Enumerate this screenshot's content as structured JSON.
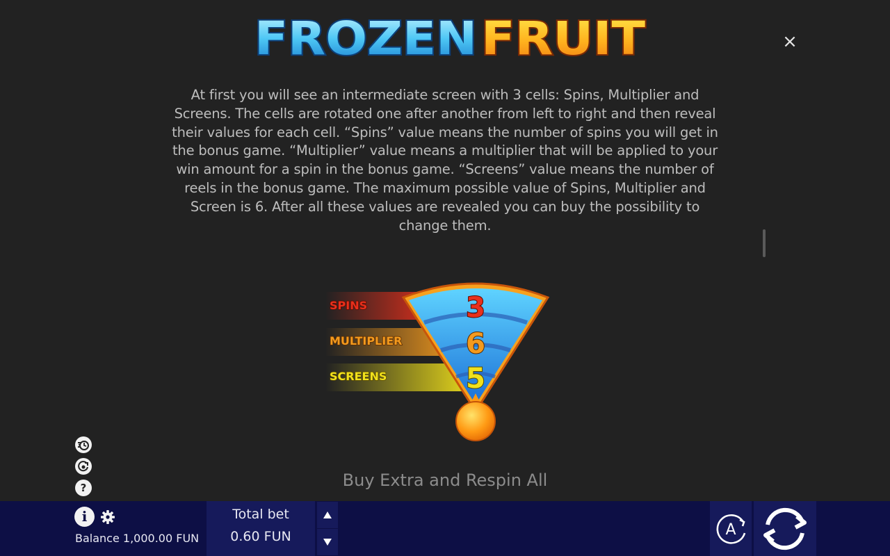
{
  "logo": {
    "text_part1": "FROZEN",
    "text_part2": "FRUIT"
  },
  "close_label": "×",
  "rules": {
    "paragraph": "At first you will see an intermediate screen with 3 cells: Spins, Multiplier and Screens. The cells are rotated one after another from left to right and then reveal their values for each cell. “Spins” value means the number of spins you will get in the bonus game. “Multiplier” value means a multiplier that will be applied to your win amount for a spin in the bonus game. “Screens” value means the number of reels in the bonus game. The maximum possible value of Spins, Multiplier and Screen is 6. After all these values are revealed you can buy the possibility to change them.",
    "illustration": {
      "rows": [
        {
          "label": "SPINS",
          "value": "3",
          "color": "#e8301c"
        },
        {
          "label": "MULTIPLIER",
          "value": "6",
          "color": "#f39a1e"
        },
        {
          "label": "SCREENS",
          "value": "5",
          "color": "#f1e11c"
        }
      ]
    },
    "next_heading": "Buy Extra and Respin All"
  },
  "side_icons": [
    "turbo-icon",
    "autoplay-history-icon",
    "help-icon"
  ],
  "side_help_glyph": "?",
  "bottom_bar": {
    "info_glyph": "i",
    "balance_text": "Balance 1,000.00 FUN",
    "total_bet_label": "Total bet",
    "total_bet_value": "0.60 FUN",
    "auto_label": "A",
    "colors": {
      "bar": "#0d0f45",
      "panel": "#161a5b"
    }
  }
}
